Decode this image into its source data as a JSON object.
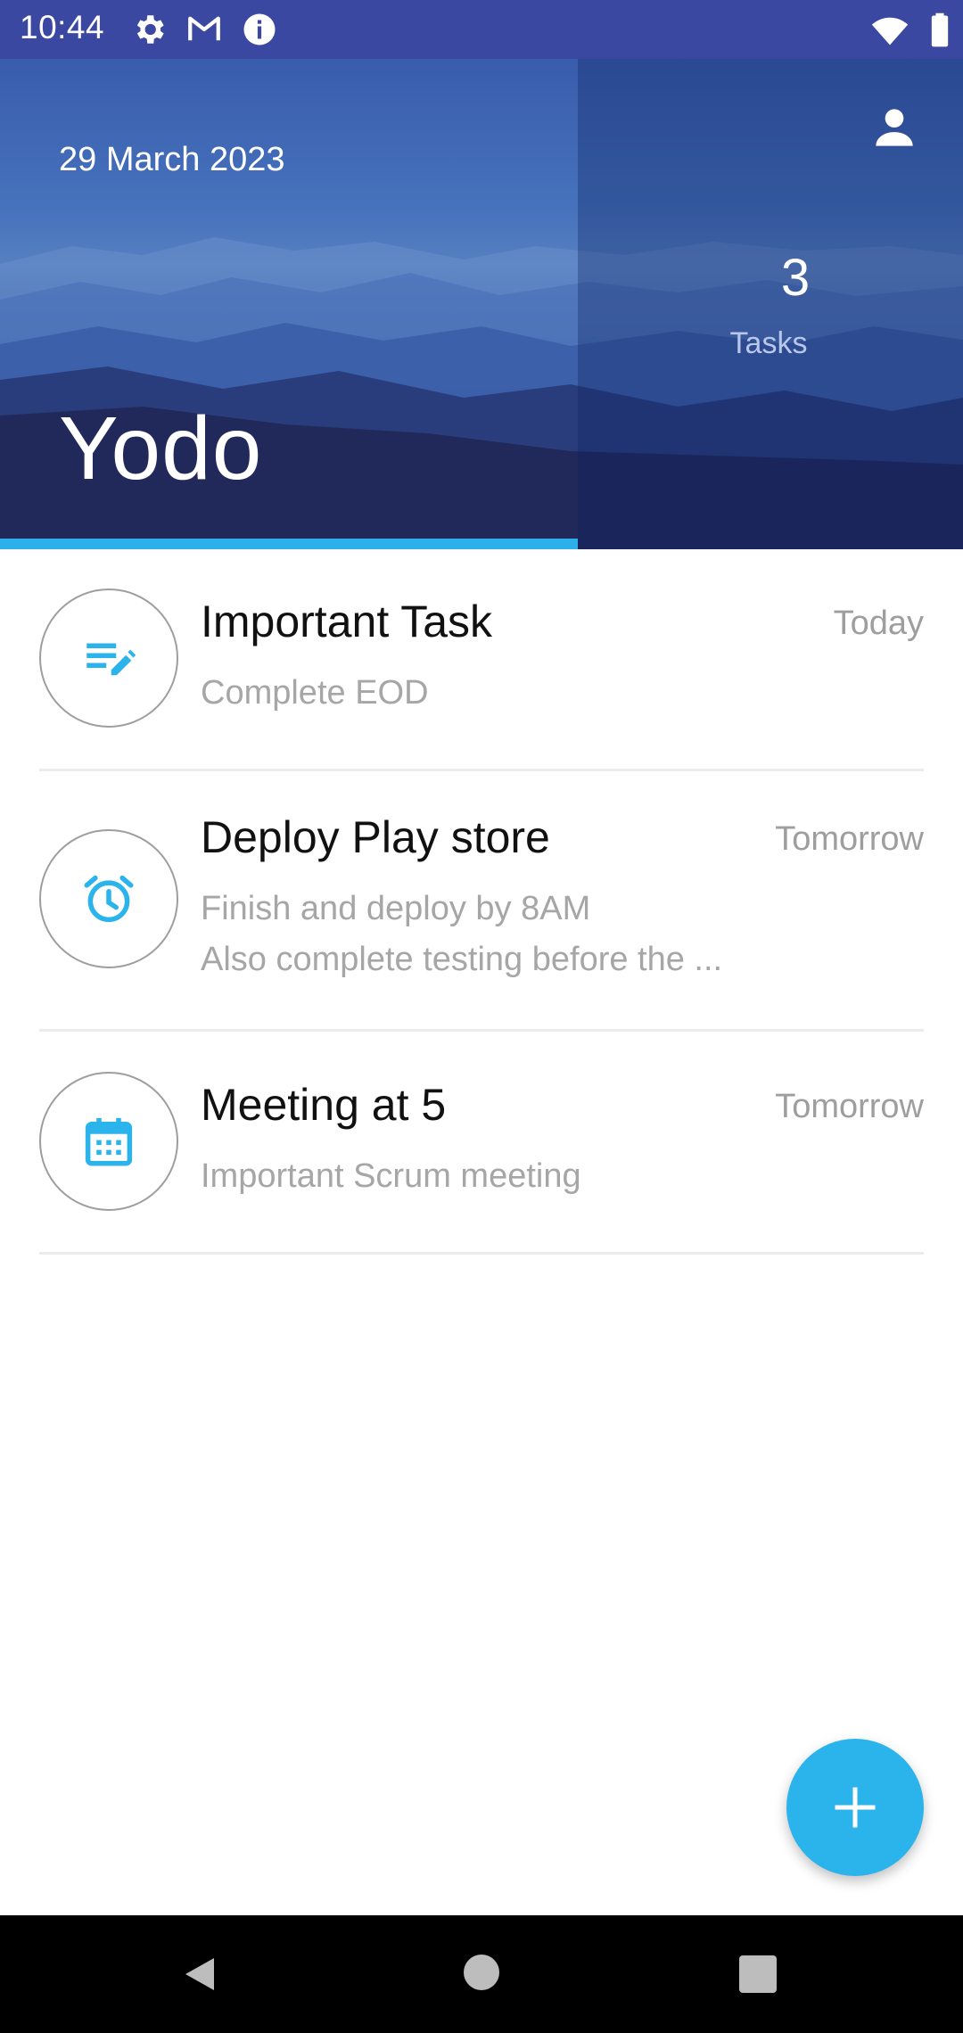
{
  "status_bar": {
    "time": "10:44",
    "icons": [
      "settings-icon",
      "gmail-icon",
      "info-icon",
      "wifi-icon",
      "battery-icon"
    ]
  },
  "header": {
    "date": "29 March 2023",
    "app_title": "Yodo",
    "task_count": "3",
    "task_count_label": "Tasks",
    "progress": 0.6,
    "icons": [
      "profile-icon"
    ]
  },
  "tasks": [
    {
      "title": "Important Task",
      "when": "Today",
      "description": [
        "Complete EOD"
      ],
      "icon": "edit-note-icon"
    },
    {
      "title": "Deploy Play store",
      "when": "Tomorrow",
      "description": [
        "Finish and deploy by 8AM",
        "Also complete testing before the ..."
      ],
      "icon": "alarm-clock-icon"
    },
    {
      "title": "Meeting at 5",
      "when": "Tomorrow",
      "description": [
        "Important Scrum meeting"
      ],
      "icon": "calendar-icon"
    }
  ],
  "fab": {
    "icon": "plus-icon"
  },
  "nav_bar": {
    "icons": [
      "back-icon",
      "home-icon",
      "recents-icon"
    ]
  },
  "colors": {
    "status_bar": "#3b48a2",
    "accent": "#2bb3ec",
    "title_text": "#111111",
    "secondary_text": "#9e9e9e"
  }
}
